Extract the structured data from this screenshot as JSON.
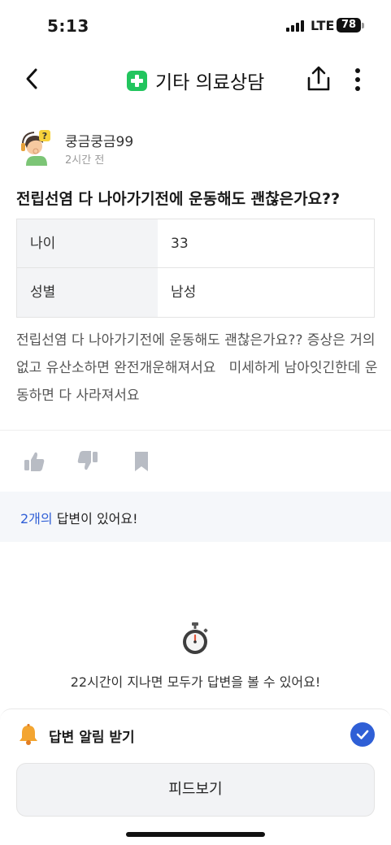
{
  "status_bar": {
    "time": "5:13",
    "network": "LTE",
    "battery": "78"
  },
  "nav": {
    "title": "기타 의료상담",
    "back_icon": "chevron-left-icon",
    "category_icon": "green-cross-icon",
    "share_icon": "share-icon",
    "more_icon": "more-vertical-icon"
  },
  "author": {
    "name": "쿵금쿵금99",
    "time": "2시간 전"
  },
  "post": {
    "title": "전립선염 다 나아가기전에 운동해도 괜찮은가요??",
    "info": [
      {
        "label": "나이",
        "value": "33"
      },
      {
        "label": "성별",
        "value": "남성"
      }
    ],
    "body": "전립선염 다 나아가기전에 운동해도 괜찮은가요?? 증상은 거의없고 유산소하면 완전개운해져서요   미세하게 남아잇긴한데 운동하면 다 사라져서요"
  },
  "answers": {
    "count": "2개의",
    "text": " 답변이 있어요!"
  },
  "wait_message": "22시간이 지나면 모두가 답변을 볼 수 있어요!",
  "bottom": {
    "alert_label": "답변 알림 받기",
    "feed_button": "피드보기",
    "alert_checked": true
  },
  "colors": {
    "accent": "#2f5fd6",
    "category_green": "#22c55e"
  }
}
